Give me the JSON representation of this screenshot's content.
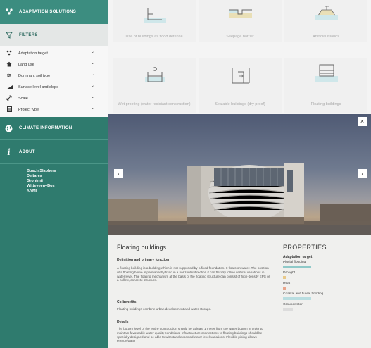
{
  "sidebar": {
    "adaptation_title": "ADAPTATION SOLUTIONS",
    "filters_title": "FILTERS",
    "filters": [
      {
        "label": "Adaptation target",
        "icon": "target-icon"
      },
      {
        "label": "Land use",
        "icon": "house-icon"
      },
      {
        "label": "Dominant soil type",
        "icon": "waves-icon"
      },
      {
        "label": "Surface level and slope",
        "icon": "slope-icon"
      },
      {
        "label": "Scale",
        "icon": "scale-icon"
      },
      {
        "label": "Project type",
        "icon": "project-icon"
      }
    ],
    "climate_title": "CLIMATE INFORMATION",
    "about_title": "ABOUT",
    "credits": [
      "Bosch Slabbers",
      "Deltares",
      "Grontmij",
      "Witteveen+Bos",
      "KNMI"
    ]
  },
  "tiles": [
    {
      "label": "Use of buildings as flood defense",
      "icon": "flood-defense-building-icon"
    },
    {
      "label": "Seepage barrier",
      "icon": "seepage-barrier-icon"
    },
    {
      "label": "Artificial islands",
      "icon": "artificial-island-icon"
    },
    {
      "label": "Wet proofing (water resistant construction)",
      "icon": "wet-proofing-icon"
    },
    {
      "label": "Sealable buildings (dry proof)",
      "icon": "sealable-building-icon"
    },
    {
      "label": "Floating buildings",
      "icon": "floating-building-icon"
    }
  ],
  "viewer": {
    "close_glyph": "×",
    "prev_glyph": "‹",
    "next_glyph": "›"
  },
  "details": {
    "title": "Floating buildings",
    "definition_heading": "Definition and primary function",
    "definition_text": "A floating building is a building which is not supported by a fixed foundation. It floats on water. The position of a floating home is permanently fixed in a horizontal direction it can flexibly follow vertical variations in water level. The floating mechanism at the basis of the floating structure can consist of high-density EPS or a hollow, concrete structure.",
    "cobenefits_heading": "Co-benefits",
    "cobenefits_text": "Floating buildings combine urban development and water storage.",
    "details_heading": "Details",
    "details_text": "The bottom level of the entire construction should be at least 1 meter from the water bottom in order to maintain favourable water quality conditions. Infrastructure connections to floating buildings should be specially designed and be able to withstand expected water level variations. Flexible piping allows energy/water"
  },
  "properties": {
    "title": "PROPERTIES",
    "subtitle": "Adaptation target",
    "items": [
      {
        "label": "Pluvial flooding",
        "value": 0.55,
        "color": "#8fc9c8"
      },
      {
        "label": "Drought",
        "value": 0.05,
        "color": "#e8c98a"
      },
      {
        "label": "Heat",
        "value": 0.05,
        "color": "#e8a48a"
      },
      {
        "label": "Coastal and fluvial flooding",
        "value": 0.55,
        "color": "#b9dde0"
      },
      {
        "label": "Groundwater",
        "value": 0.2,
        "color": "#dcdcdc"
      }
    ]
  }
}
